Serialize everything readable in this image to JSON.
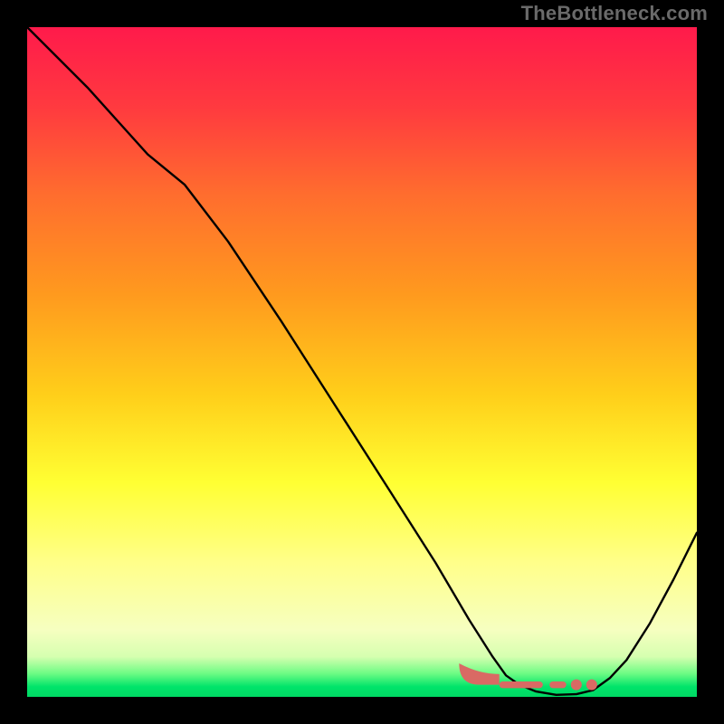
{
  "watermark": "TheBottleneck.com",
  "plot": {
    "inner_x": 30,
    "inner_y": 30,
    "inner_w": 740,
    "inner_h": 740
  },
  "gradient_stops": [
    {
      "offset": 0.0,
      "color": "#ff1a4b"
    },
    {
      "offset": 0.12,
      "color": "#ff3a3f"
    },
    {
      "offset": 0.25,
      "color": "#ff6d2e"
    },
    {
      "offset": 0.4,
      "color": "#ff9a1e"
    },
    {
      "offset": 0.55,
      "color": "#ffcf1a"
    },
    {
      "offset": 0.68,
      "color": "#ffff33"
    },
    {
      "offset": 0.8,
      "color": "#ffff8a"
    },
    {
      "offset": 0.9,
      "color": "#f6ffc0"
    },
    {
      "offset": 0.94,
      "color": "#d6ffb0"
    },
    {
      "offset": 0.965,
      "color": "#6efc84"
    },
    {
      "offset": 0.985,
      "color": "#00e46a"
    },
    {
      "offset": 1.0,
      "color": "#00d864"
    }
  ],
  "curve_points": [
    {
      "x": 0.0,
      "y": 1.0
    },
    {
      "x": 0.09,
      "y": 0.91
    },
    {
      "x": 0.18,
      "y": 0.81
    },
    {
      "x": 0.235,
      "y": 0.765
    },
    {
      "x": 0.3,
      "y": 0.68
    },
    {
      "x": 0.38,
      "y": 0.56
    },
    {
      "x": 0.46,
      "y": 0.435
    },
    {
      "x": 0.54,
      "y": 0.31
    },
    {
      "x": 0.61,
      "y": 0.2
    },
    {
      "x": 0.66,
      "y": 0.115
    },
    {
      "x": 0.695,
      "y": 0.06
    },
    {
      "x": 0.715,
      "y": 0.032
    },
    {
      "x": 0.735,
      "y": 0.018
    },
    {
      "x": 0.76,
      "y": 0.008
    },
    {
      "x": 0.79,
      "y": 0.003
    },
    {
      "x": 0.82,
      "y": 0.004
    },
    {
      "x": 0.845,
      "y": 0.01
    },
    {
      "x": 0.87,
      "y": 0.028
    },
    {
      "x": 0.895,
      "y": 0.055
    },
    {
      "x": 0.93,
      "y": 0.11
    },
    {
      "x": 0.965,
      "y": 0.175
    },
    {
      "x": 1.0,
      "y": 0.245
    }
  ],
  "bottom_marks": {
    "base_y": 0.018,
    "blobs": [
      {
        "x0": 0.645,
        "x1": 0.705,
        "h": 0.032,
        "sweep_down": true
      },
      {
        "x0": 0.705,
        "x1": 0.77,
        "h": 0.01,
        "sweep_down": false
      },
      {
        "x0": 0.78,
        "x1": 0.805,
        "h": 0.01,
        "sweep_down": false
      }
    ],
    "dots": [
      {
        "x": 0.82,
        "r": 6
      },
      {
        "x": 0.843,
        "r": 6
      }
    ],
    "color": "#d96a64"
  },
  "chart_data": {
    "type": "line",
    "title": "",
    "xlabel": "",
    "ylabel": "",
    "xlim": [
      0,
      1
    ],
    "ylim": [
      0,
      1
    ],
    "series": [
      {
        "name": "curve",
        "x": [
          0.0,
          0.09,
          0.18,
          0.235,
          0.3,
          0.38,
          0.46,
          0.54,
          0.61,
          0.66,
          0.695,
          0.715,
          0.735,
          0.76,
          0.79,
          0.82,
          0.845,
          0.87,
          0.895,
          0.93,
          0.965,
          1.0
        ],
        "y": [
          1.0,
          0.91,
          0.81,
          0.765,
          0.68,
          0.56,
          0.435,
          0.31,
          0.2,
          0.115,
          0.06,
          0.032,
          0.018,
          0.008,
          0.003,
          0.004,
          0.01,
          0.028,
          0.055,
          0.11,
          0.175,
          0.245
        ]
      }
    ],
    "annotations": [
      "TheBottleneck.com"
    ],
    "legend": false,
    "grid": false,
    "background_gradient": "vertical red→yellow→green"
  }
}
